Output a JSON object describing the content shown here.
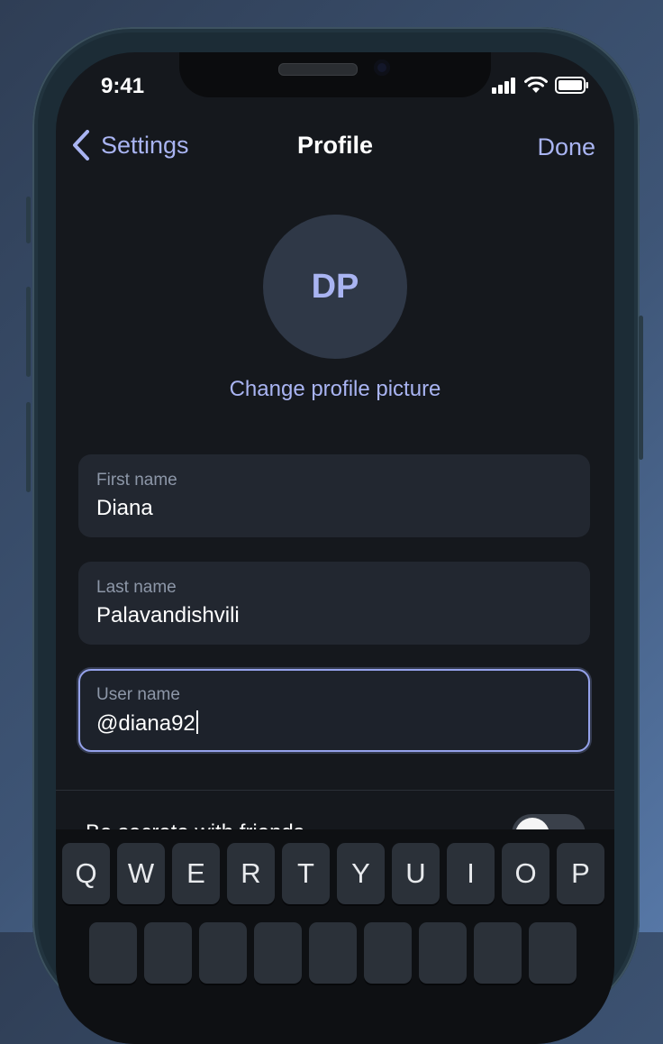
{
  "status_bar": {
    "time": "9:41"
  },
  "nav": {
    "back_label": "Settings",
    "title": "Profile",
    "done_label": "Done"
  },
  "profile": {
    "initials": "DP",
    "change_picture_label": "Change profile picture"
  },
  "fields": [
    {
      "label": "First name",
      "value": "Diana"
    },
    {
      "label": "Last name",
      "value": "Palavandishvili"
    },
    {
      "label": "User name",
      "value": "@diana92"
    }
  ],
  "settings": {
    "row_label": "Be secrete with friends",
    "toggle_on": false
  },
  "keyboard": {
    "row1": [
      "Q",
      "W",
      "E",
      "R",
      "T",
      "Y",
      "U",
      "I",
      "O",
      "P"
    ]
  },
  "colors": {
    "accent": "#a9b4f2",
    "background": "#15181d",
    "field_bg": "#222730"
  }
}
